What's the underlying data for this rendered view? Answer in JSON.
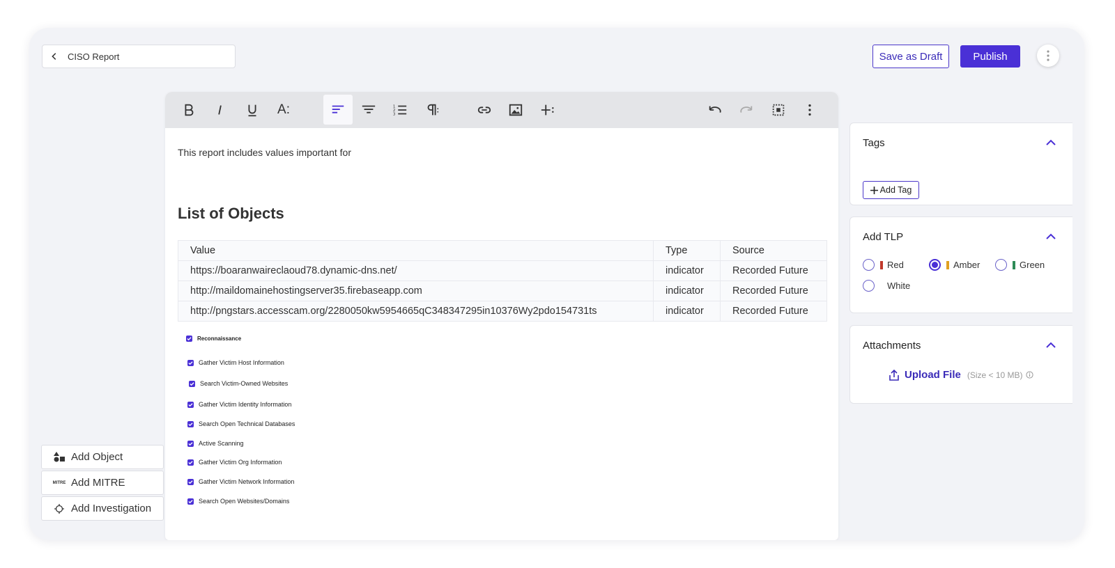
{
  "header": {
    "report_title": "CISO Report",
    "save_draft_label": "Save as Draft",
    "publish_label": "Publish"
  },
  "toolbar": {
    "buttons": [
      "bold-icon",
      "italic-icon",
      "underline-icon",
      "font-size-icon",
      "align-left-icon",
      "align-center-icon",
      "ordered-list-icon",
      "paragraph-icon",
      "link-icon",
      "image-icon",
      "insert-more-icon",
      "undo-icon",
      "redo-icon",
      "select-all-icon",
      "more-vertical-icon"
    ],
    "text_style_label": "A:",
    "active": "align-left-icon"
  },
  "editor": {
    "intro": "This report includes values important for",
    "heading": "List of Objects",
    "table": {
      "headers": [
        "Value",
        "Type",
        "Source"
      ],
      "rows": [
        [
          "https://boaranwaireclaoud78.dynamic-dns.net/",
          "indicator",
          "Recorded Future"
        ],
        [
          "http://maildomainehostingserver35.firebaseapp.com",
          "indicator",
          "Recorded Future"
        ],
        [
          "http://pngstars.accesscam.org/2280050kw5954665qC348347295in10376Wy2pdo154731ts",
          "indicator",
          "Recorded Future"
        ]
      ]
    },
    "mitre": {
      "root": "Reconnaissance",
      "items": [
        "Gather Victim Host Information",
        "Search Victim-Owned Websites",
        "Gather Victim Identity Information",
        "Search Open Technical Databases",
        "Active Scanning",
        "Gather Victim Org Information",
        "Gather Victim Network Information",
        "Search Open Websites/Domains"
      ]
    }
  },
  "left_actions": {
    "add_object": "Add Object",
    "add_mitre": "Add MITRE",
    "add_mitre_icon_text": "MITRE",
    "add_investigation": "Add Investigation"
  },
  "panels": {
    "tags": {
      "title": "Tags",
      "add_tag_label": "Add Tag"
    },
    "tlp": {
      "title": "Add TLP",
      "options": [
        {
          "label": "Red",
          "color": "#c0392b",
          "selected": false
        },
        {
          "label": "Amber",
          "color": "#e0a020",
          "selected": true
        },
        {
          "label": "Green",
          "color": "#2e8b57",
          "selected": false
        },
        {
          "label": "White",
          "color": "#ffffff",
          "selected": false
        }
      ]
    },
    "attachments": {
      "title": "Attachments",
      "upload_label": "Upload File",
      "size_hint": "(Size < 10 MB)"
    }
  },
  "colors": {
    "accent": "#4a30d6",
    "canvas": "#f2f3f7",
    "toolbar": "#e4e5e8"
  }
}
